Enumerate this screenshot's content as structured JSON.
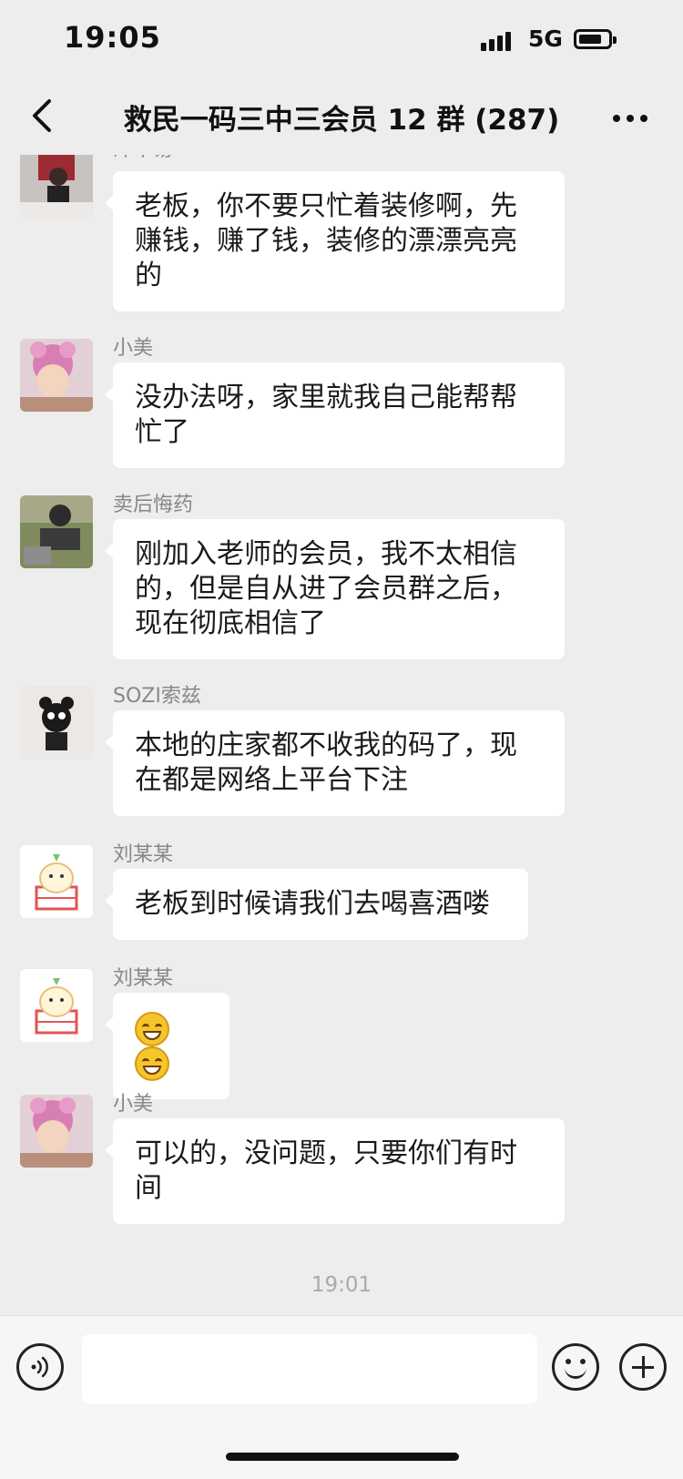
{
  "status_bar": {
    "time": "19:05",
    "network": "5G",
    "battery_level": 0.8
  },
  "nav": {
    "title": "救民一码三中三会员 12 群 (287)",
    "back_icon": "chevron-left-icon",
    "more_icon": "more-icon"
  },
  "messages": [
    {
      "sender": "洋不易",
      "text": "老板，你不要只忙着装修啊，先赚钱，赚了钱，装修的漂漂亮亮的",
      "avatar_color": "#b9b3b0"
    },
    {
      "sender": "小美",
      "text": "没办法呀，家里就我自己能帮帮忙了",
      "avatar_color": "#d8a9c6"
    },
    {
      "sender": "卖后悔药",
      "text": "刚加入老师的会员，我不太相信的，但是自从进了会员群之后，现在彻底相信了",
      "avatar_color": "#6f7a5a"
    },
    {
      "sender": "SOZI索兹",
      "text": "本地的庄家都不收我的码了，现在都是网络上平台下注",
      "avatar_color": "#e7e4e1"
    },
    {
      "sender": "刘某某",
      "text": "老板到时候请我们去喝喜酒喽",
      "avatar_color": "#fbeed7"
    },
    {
      "sender": "刘某某",
      "text": "",
      "emoji": [
        "grin-emoji",
        "grin-emoji"
      ],
      "avatar_color": "#fbeed7"
    },
    {
      "sender": "小美",
      "text": "可以的，没问题，只要你们有时间",
      "avatar_color": "#d8a9c6"
    }
  ],
  "timestamp": "19:01",
  "input_bar": {
    "voice_icon": "voice-icon",
    "emoji_icon": "emoji-icon",
    "plus_icon": "plus-icon",
    "placeholder": ""
  }
}
